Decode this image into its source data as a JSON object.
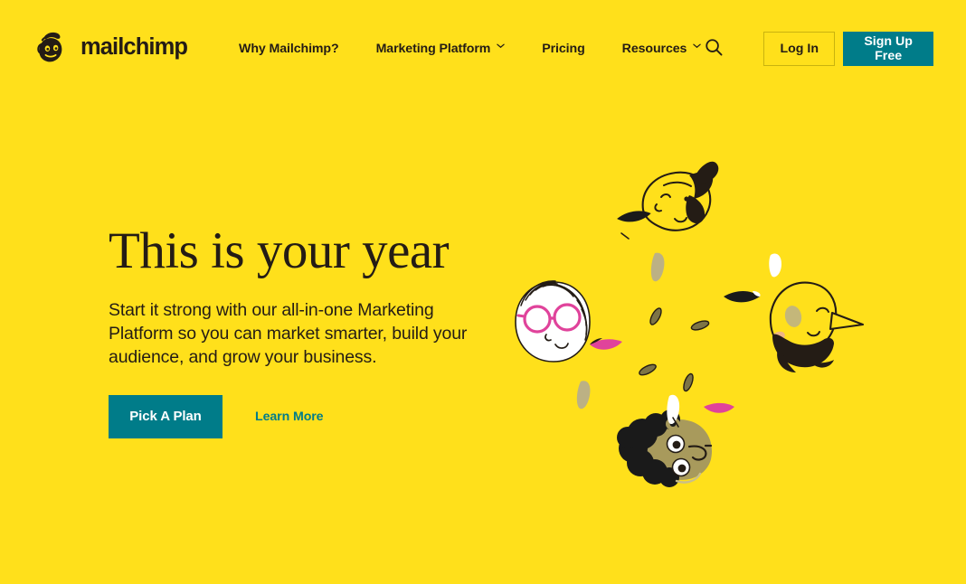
{
  "brand": {
    "name": "mailchimp",
    "logo_icon": "mailchimp-freddie-monkey-logo",
    "yellow": "#FFE01B",
    "teal": "#007C89",
    "ink": "#241C15",
    "magenta": "#E0439B"
  },
  "header": {
    "nav": [
      {
        "label": "Why Mailchimp?",
        "has_dropdown": false
      },
      {
        "label": "Marketing Platform",
        "has_dropdown": true
      },
      {
        "label": "Pricing",
        "has_dropdown": false
      },
      {
        "label": "Resources",
        "has_dropdown": true
      }
    ],
    "search_icon": "search-icon",
    "login_label": "Log In",
    "signup_label": "Sign Up Free"
  },
  "hero": {
    "title": "This is your year",
    "subtitle": "Start it strong with our all-in-one Marketing Platform so you can market smarter, build your audience, and grow your business.",
    "primary_cta": "Pick A Plan",
    "secondary_cta": "Learn More",
    "illustration_alt": "Four illustrated faces surrounded by confetti made of facial features"
  }
}
